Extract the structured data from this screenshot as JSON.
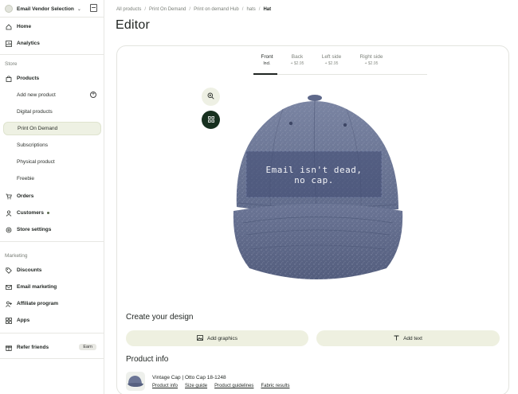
{
  "sidebar": {
    "store_name": "Email Vendor Selection",
    "items": {
      "home": "Home",
      "analytics": "Analytics",
      "store_section": "Store",
      "products": "Products",
      "add_new_product": "Add new product",
      "digital_products": "Digital products",
      "print_on_demand": "Print On Demand",
      "subscriptions": "Subscriptions",
      "physical_product": "Physical product",
      "freebie": "Freebie",
      "orders": "Orders",
      "customers": "Customers",
      "store_settings": "Store settings",
      "marketing_section": "Marketing",
      "discounts": "Discounts",
      "email_marketing": "Email marketing",
      "affiliate_program": "Affiliate program",
      "apps": "Apps",
      "refer_friends": "Refer friends",
      "earn_badge": "Earn"
    }
  },
  "breadcrumb": {
    "all_products": "All products",
    "print_on_demand": "Print On Demand",
    "hub": "Print on demand Hub",
    "hats": "hats",
    "current": "Hat",
    "sep": "/"
  },
  "page_title": "Editor",
  "view_tabs": [
    {
      "label": "Front",
      "price": "Incl."
    },
    {
      "label": "Back",
      "price": "+ $2.95"
    },
    {
      "label": "Left side",
      "price": "+ $2.95"
    },
    {
      "label": "Right side",
      "price": "+ $2.95"
    }
  ],
  "design": {
    "text_line1": "Email isn't dead,",
    "text_line2": "no cap."
  },
  "create_design": {
    "title": "Create your design",
    "add_graphics": "Add graphics",
    "add_text": "Add text"
  },
  "product_info": {
    "title": "Product info",
    "name": "Vintage Cap | Otto Cap 18-1248",
    "links": [
      "Product info",
      "Size guide",
      "Product guidelines",
      "Fabric results"
    ]
  },
  "colors": {
    "accent_dark": "#17301f",
    "accent_light": "#eef0e0",
    "cap_denim": "#6d7898"
  },
  "icons": {
    "zoom": "zoom-in-icon",
    "grid": "grid-icon"
  }
}
